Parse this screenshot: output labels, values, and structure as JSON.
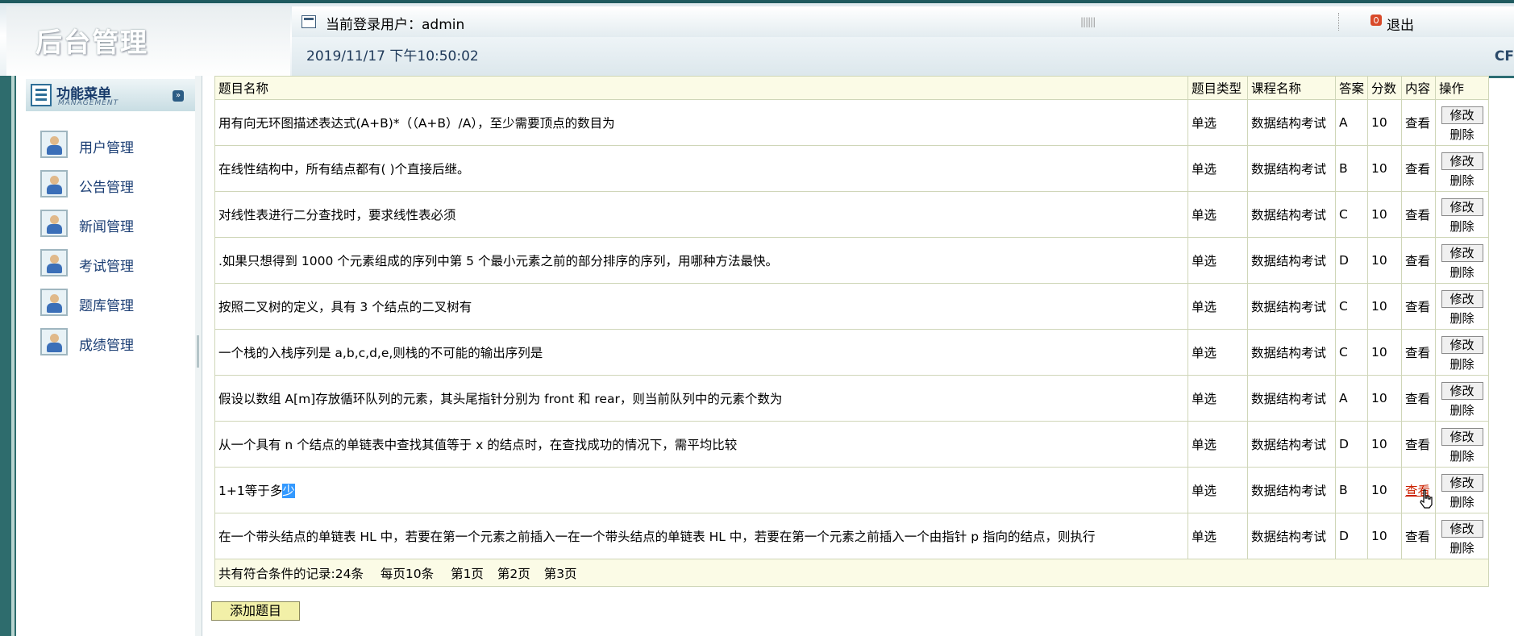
{
  "header": {
    "logo_text": "后台管理",
    "current_user_label": "当前登录用户：admin",
    "datetime": "2019/11/17 下午10:50:02",
    "logout_label": "退出",
    "grip_text": "||||||",
    "right_badge": "CF"
  },
  "sidebar": {
    "title": "功能菜单",
    "subtitle": "MANAGEMENT",
    "collapse_glyph": "»",
    "items": [
      {
        "label": "用户管理"
      },
      {
        "label": "公告管理"
      },
      {
        "label": "新闻管理"
      },
      {
        "label": "考试管理"
      },
      {
        "label": "题库管理"
      },
      {
        "label": "成绩管理"
      }
    ]
  },
  "table": {
    "headers": {
      "title": "题目名称",
      "type": "题目类型",
      "course": "课程名称",
      "answer": "答案",
      "score": "分数",
      "content": "内容",
      "ops": "操作"
    },
    "view_label": "查看",
    "edit_label": "修改",
    "delete_label": "删除",
    "rows": [
      {
        "title": "用有向无环图描述表达式(A+B)*（（A+B）/A），至少需要顶点的数目为",
        "type": "单选",
        "course": "数据结构考试",
        "answer": "A",
        "score": "10"
      },
      {
        "title": "在线性结构中，所有结点都有( )个直接后继。",
        "type": "单选",
        "course": "数据结构考试",
        "answer": "B",
        "score": "10"
      },
      {
        "title": "对线性表进行二分查找时，要求线性表必须",
        "type": "单选",
        "course": "数据结构考试",
        "answer": "C",
        "score": "10"
      },
      {
        "title": ".如果只想得到 1000 个元素组成的序列中第 5 个最小元素之前的部分排序的序列，用哪种方法最快。",
        "type": "单选",
        "course": "数据结构考试",
        "answer": "D",
        "score": "10"
      },
      {
        "title": "按照二叉树的定义，具有 3 个结点的二叉树有",
        "type": "单选",
        "course": "数据结构考试",
        "answer": "C",
        "score": "10"
      },
      {
        "title": "一个栈的入栈序列是 a,b,c,d,e,则栈的不可能的输出序列是",
        "type": "单选",
        "course": "数据结构考试",
        "answer": "C",
        "score": "10"
      },
      {
        "title": "假设以数组 A[m]存放循环队列的元素，其头尾指针分别为 front 和 rear，则当前队列中的元素个数为",
        "type": "单选",
        "course": "数据结构考试",
        "answer": "A",
        "score": "10"
      },
      {
        "title": "从一个具有 n 个结点的单链表中查找其值等于 x 的结点时，在查找成功的情况下，需平均比较",
        "type": "单选",
        "course": "数据结构考试",
        "answer": "D",
        "score": "10"
      },
      {
        "title_main": "1+1等于多",
        "title_sel": "少",
        "type": "单选",
        "course": "数据结构考试",
        "answer": "B",
        "score": "10"
      },
      {
        "title": "在一个带头结点的单链表 HL 中，若要在第一个元素之前插入一在一个带头结点的单链表 HL 中，若要在第一个元素之前插入一个由指针 p 指向的结点，则执行",
        "type": "单选",
        "course": "数据结构考试",
        "answer": "D",
        "score": "10"
      }
    ],
    "footer": {
      "total": "共有符合条件的记录:24条",
      "per_page": "每页10条",
      "pages": [
        "第1页",
        "第2页",
        "第3页"
      ]
    }
  },
  "actions": {
    "add_label": "添加题目"
  },
  "colors": {
    "frame": "#2e6c6d",
    "table_header_bg": "#fbfbe6",
    "add_button_bg": "#f2f0a8",
    "hover_link": "#cc2200",
    "selection": "#3399ff"
  }
}
